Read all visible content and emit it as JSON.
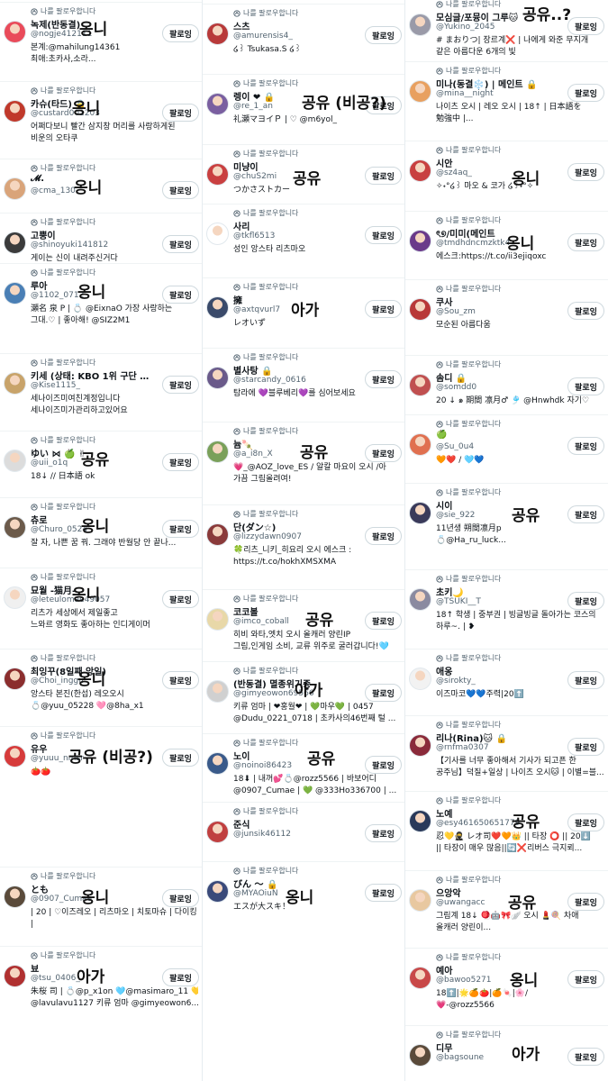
{
  "follows_you_label": "나를 팔로우합니다",
  "follow_label": "팔로잉",
  "columns": [
    {
      "cards": [
        {
          "name": "녹제(반동결)",
          "handle": "@nogje412111",
          "bio": [
            "본계:@mahilung14361",
            "최애:초카사,소라..."
          ],
          "note": "옹니",
          "color": "#e94b5a"
        },
        {
          "name": "카슈(타드) 🔒",
          "handle": "@custard001203",
          "bio": [
            "어쩌다보니 빨간 삼지창 머리를 사랑하게된",
            "비운의 오타쿠"
          ],
          "note": "옹니",
          "color": "#c0392b"
        },
        {
          "name": "𝓜.",
          "handle": "@cma_130",
          "bio": [],
          "note": "옹니",
          "color": "#d9a47a"
        },
        {
          "name": "고뿡이",
          "handle": "@shinoyuki141812",
          "bio": [
            "게이는 신이 내려주신거다"
          ],
          "note": "",
          "color": "#3b3b3b"
        },
        {
          "name": "루아",
          "handle": "@1102_0712",
          "bio": [
            "瀬名 泉 P | 💍 @EixnaO 가장 사랑하는",
            "그대.♡ | 좋아해! @SIZ2M1"
          ],
          "note": "옹니",
          "color": "#4a7fb5"
        },
        {
          "name": "키세 (상태: KBO 1위 구단 삼...",
          "handle": "@Kise1115_",
          "bio": [
            "세나이즈미여친계정입니다",
            "세나이즈미가관리하고있어요"
          ],
          "note": "",
          "color": "#c8a36a"
        },
        {
          "name": "ゆい ⋈ 🍏 ✌",
          "handle": "@uii_o1q",
          "bio": [
            "18↓ // 日本語 ok"
          ],
          "note": "공유",
          "color": "#dcdcdc"
        },
        {
          "name": "츄로",
          "handle": "@Churo_0524",
          "bio": [
            "잘 자, 나쁜 꿈 꿔. 그래야 반월당 안 끝나..."
          ],
          "note": "옹니",
          "color": "#6b5a4a"
        },
        {
          "name": "묘월 -猫月-",
          "handle": "@leteulomae49057",
          "bio": [
            "리츠가 세상에서 제일좋고",
            "느와르 영화도 좋아하는 인디게이머"
          ],
          "note": "옹니",
          "color": "#f0f0f0"
        },
        {
          "name": "최잉꾸(8일째 앙일)",
          "handle": "@Choi_inggu",
          "bio": [
            "앙스타 본진(한섭) 레오오시",
            "💍@yuu_05228 🩷@8ha_x1"
          ],
          "note": "옹니",
          "color": "#8b2e2e"
        },
        {
          "name": "유우",
          "handle": "@yuuu_nmsr",
          "bio": [
            "🍅🍅"
          ],
          "note": "공유 (비공?)",
          "color": "#d63b3b"
        },
        {
          "name": "とも",
          "handle": "@0907_Cumae",
          "bio": [
            "| 20 | ♡이즈레오 | 리츠마오 | 치토마슈 | 다이킹",
            "|"
          ],
          "note": "옹니",
          "color": "#5a4a3a"
        },
        {
          "name": "뵤",
          "handle": "@tsu_0406_",
          "bio": [
            "朱桜 司 | 💍@p_x1on 🩵@masimaro_11 💛",
            "@lavulavu1127 키류 엄마 @gimyeowon6..."
          ],
          "note": "아가",
          "color": "#b03030"
        }
      ]
    },
    {
      "cards": [
        {
          "name": "스츠",
          "handle": "@amurensis4_",
          "bio": [
            "໒꒱ Tsukasa.S ໒꒱"
          ],
          "note": "",
          "color": "#b83a3a"
        },
        {
          "name": "렝이 ❤ 🔒",
          "handle": "@re_1_an",
          "bio": [
            "礼瀬マヨイＰ | ♡ @m6yol_"
          ],
          "note": "공유 (비공?)",
          "color": "#7a5fa0"
        },
        {
          "name": "미냥이",
          "handle": "@chuS2mi",
          "bio": [
            "つかさストカー"
          ],
          "note": "공유",
          "color": "#c94040"
        },
        {
          "name": "사리",
          "handle": "@tkfl6513",
          "bio": [
            "성인 앙스타 리츠마오"
          ],
          "note": "",
          "color": "#ffffff"
        },
        {
          "name": "擁",
          "handle": "@axtqvurl7",
          "bio": [
            "レオいず"
          ],
          "note": "아가",
          "color": "#3a4a6a"
        },
        {
          "name": "별사탕 🔒",
          "handle": "@starcandy_0616",
          "bio": [
            "탐라에 💜블루베리💜를 심어보세요"
          ],
          "note": "",
          "color": "#6a5a8a"
        },
        {
          "name": "늄🍡",
          "handle": "@a_i8n_X",
          "bio": [
            "💗_@AOZ_love_ES / 알칼 마요이 오시 /아",
            "가끔 그림올려여!"
          ],
          "note": "공유",
          "color": "#7aa05a"
        },
        {
          "name": "단(ダン☆)",
          "handle": "@lizzydawn0907",
          "bio": [
            "🍀리츠_니키_히요리 오시 에스크 :",
            "https://t.co/hokhXMSXMA"
          ],
          "note": "",
          "color": "#8a3a3a"
        },
        {
          "name": "코코볼",
          "handle": "@imco_coball",
          "bio": [
            "히비 와타,엣치 오시 올캐러 양린IP",
            "그림,인게임 소비, 교류 위주로 굴러갑니다!🩵"
          ],
          "note": "공유",
          "color": "#e8d8a8"
        },
        {
          "name": "(반동결) 멸종위기종",
          "handle": "@gimyeowon69566",
          "bio": [
            "키류 엄마 | ❤홍월❤ | 💚마우💚 | 0457",
            "@Dudu_0221_0718 | 초카사의46번째 털 ..."
          ],
          "note": "아가",
          "color": "#d0d0d0"
        },
        {
          "name": "노이",
          "handle": "@noinoi86423",
          "bio": [
            "18⬇ | 내꺼💕💍@rozz5566 | 바보어디",
            "@0907_Cumae | 💚 @333Ho336700 | ..."
          ],
          "note": "공유",
          "color": "#3a5a8a"
        },
        {
          "name": "준식",
          "handle": "@junsik46112",
          "bio": [],
          "note": "",
          "color": "#c04040"
        },
        {
          "name": "びん 〜 🔒",
          "handle": "@MYAOiuN",
          "bio": [
            "エスが大スキ！"
          ],
          "note": "옹니",
          "color": "#3a4a7a"
        }
      ]
    },
    {
      "cards": [
        {
          "name": "모심글/포뮹이 그루🐱",
          "handle": "@Yukino_2045",
          "bio": [
            "# まおりつ| 장르계❌ | 나에게 와준 무지개",
            "같은 아름다운 6개의 빛"
          ],
          "note": "공유..?",
          "color": "#9a9aa8"
        },
        {
          "name": "미나(동결❄️) | 메인트 🔒",
          "handle": "@mina__night",
          "bio": [
            "나이츠 오시 | 레오 오시 | 18↑ | 日本語を",
            "勉強中 |..."
          ],
          "note": "",
          "color": "#e8a060"
        },
        {
          "name": "시안",
          "handle": "@sz4aq_",
          "bio": [
            "✧˖°໒꒱ 마오 & 코가 ໒꒱˖°✧"
          ],
          "note": "옹니",
          "color": "#c84040"
        },
        {
          "name": "ৎ୭/미미(메인트",
          "handle": "@tmdhdncmzktk4",
          "bio": [
            "에스크:https://t.co/ii3ejiqoxc"
          ],
          "note": "옹니",
          "color": "#6a3a8a"
        },
        {
          "name": "쿠사",
          "handle": "@Sou_zm",
          "bio": [
            "모순된 아름다움"
          ],
          "note": "",
          "color": "#b83838"
        },
        {
          "name": "솜디 🔒",
          "handle": "@somdd0",
          "bio": [
            "20 ↓ ๑ 期間 凛月♂ 🎐 @Hnwhdk 자기♡"
          ],
          "note": "",
          "color": "#c05050"
        },
        {
          "name": "🍏",
          "handle": "@Su_0u4",
          "bio": [
            "🧡❤️ / 🩵💙"
          ],
          "note": "",
          "color": "#e07050"
        },
        {
          "name": "시이",
          "handle": "@sie_922",
          "bio": [
            "11년생 朔間凛月p",
            "💍@Ha_ru_luck..."
          ],
          "note": "공유",
          "color": "#3a3a5a"
        },
        {
          "name": "초키🌙",
          "handle": "@TSUKI__T",
          "bio": [
            "18↑ 학생 | 중부권 | 빙글빙글 돌아가는 코스의",
            "하루~. | ❥"
          ],
          "note": "",
          "color": "#8a8aa0"
        },
        {
          "name": "애옹",
          "handle": "@sirokty_",
          "bio": [
            "이즈마코💙💙주력|20⬆️"
          ],
          "note": "",
          "color": "#f2f2f2"
        },
        {
          "name": "리나(Rina)🐱 🔒",
          "handle": "@rnfma0307",
          "bio": [
            "【기사를 너무 좋아해서 기사가 되고픈 한",
            "공주님】덕질+일상 | 나이츠 오시🐱 | 이별=블..."
          ],
          "note": "",
          "color": "#8a2a3a"
        },
        {
          "name": "노예",
          "handle": "@esy461650651779",
          "bio": [
            "忍💛🥷 レオ司❤️🧡👑 || 타장 ⭕ || 20⬇️",
            "|| 타장이 매우 많음||🔄❌리버스 극지뢰..."
          ],
          "note": "공유",
          "color": "#2a3a5a"
        },
        {
          "name": "으앙악",
          "handle": "@uwangacc",
          "bio": [
            "그림계 18↓ 🪀🤖🎀🪽 오시 💄🍭 차애",
            "올캐러 양린이..."
          ],
          "note": "공유",
          "color": "#e8c8a0"
        },
        {
          "name": "예아",
          "handle": "@bawoo5271",
          "bio": [
            "18⬆️|🌟🍊🍅|🍊🍬|🌸/",
            "💗-@rozz5566"
          ],
          "note": "옹니",
          "color": "#c84848"
        },
        {
          "name": "디무",
          "handle": "@bagsoune",
          "bio": [],
          "note": "아가",
          "color": "#5a4a3a"
        }
      ]
    }
  ]
}
